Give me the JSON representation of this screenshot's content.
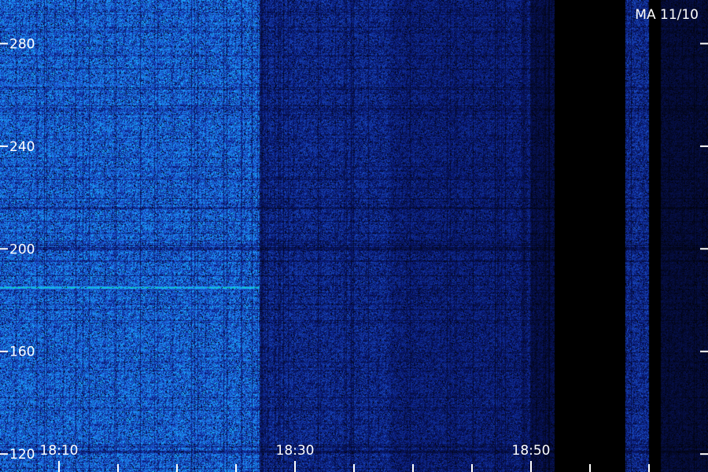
{
  "chart_data": {
    "type": "heatmap",
    "title": "MA 11/10",
    "x_tick_labels": [
      "18:10",
      "18:30",
      "18:50"
    ],
    "y_tick_labels": [
      "120",
      "160",
      "200",
      "240",
      "280"
    ],
    "y_ticks": [
      120,
      160,
      200,
      240,
      280
    ],
    "y_range": [
      113,
      297
    ],
    "x_range_minutes": [
      "18:05",
      "18:65"
    ],
    "x_minor_tick_step_minutes": 5,
    "intensity_segments": [
      {
        "start": "18:05",
        "end": "18:27",
        "level": 0.62
      },
      {
        "start": "18:27",
        "end": "18:38",
        "level": 0.36
      },
      {
        "start": "18:38",
        "end": "18:50",
        "level": 0.3
      },
      {
        "start": "18:50",
        "end": "18:52",
        "level": 0.18
      },
      {
        "start": "18:52",
        "end": "18:58",
        "level": 0.0
      },
      {
        "start": "18:58",
        "end": "18:60",
        "level": 0.38
      },
      {
        "start": "18:60",
        "end": "18:61",
        "level": 0.0
      },
      {
        "start": "18:61",
        "end": "18:65",
        "level": 0.14
      }
    ],
    "bright_lines": [
      {
        "y": 185,
        "start": "18:05",
        "end": "18:27",
        "strength": 0.95
      },
      {
        "y": 264,
        "start": "18:05",
        "end": "18:16",
        "strength": 0.6
      }
    ],
    "dark_bands": [
      {
        "y": 200,
        "strength": 0.45
      },
      {
        "y": 216,
        "strength": 0.3
      },
      {
        "y": 121,
        "strength": 0.35
      },
      {
        "y": 254,
        "strength": 0.2
      }
    ],
    "colors": {
      "low": "#000000",
      "mid": "#1a4fd0",
      "high": "#00ff70",
      "axis": "#ffffff"
    },
    "colormap": [
      "#000000",
      "#0a1a7a",
      "#1f5fe0",
      "#19b0ff",
      "#00ff70"
    ]
  }
}
